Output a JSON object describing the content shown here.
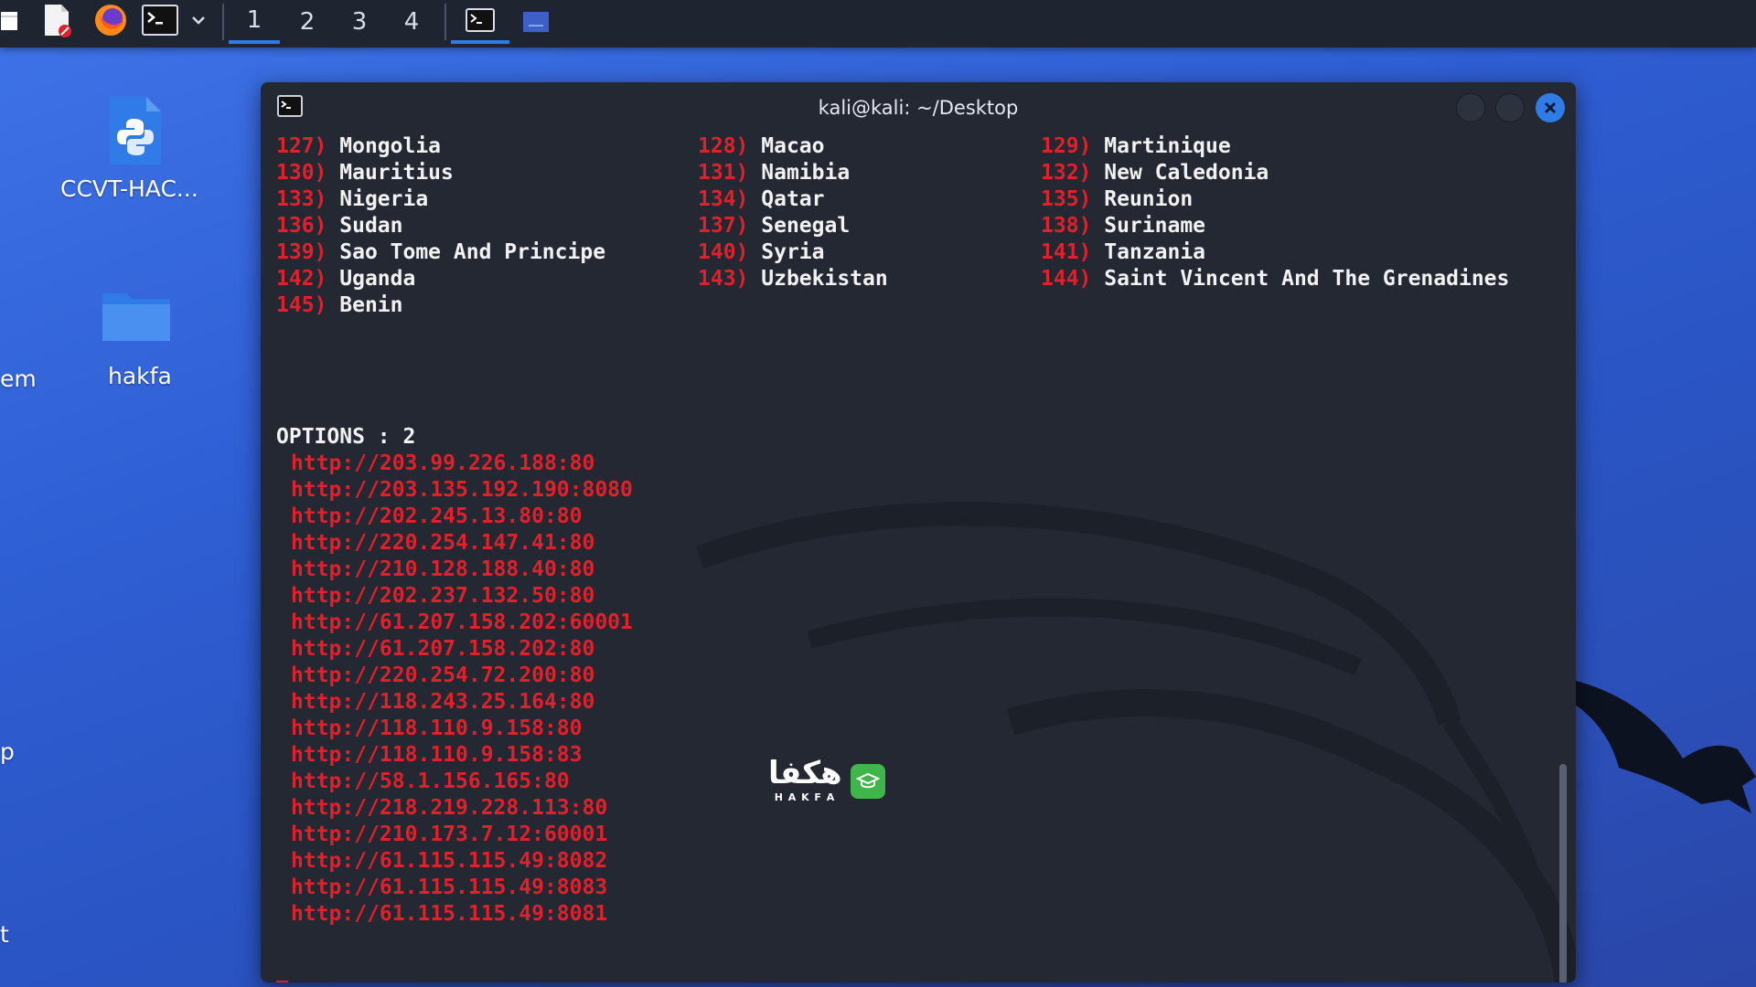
{
  "taskbar": {
    "workspaces": [
      "1",
      "2",
      "3",
      "4"
    ],
    "active_workspace": "1"
  },
  "desktop": {
    "items": [
      {
        "label": "CCVT-HAC...",
        "icon": "python-file-icon"
      },
      {
        "label": "hakfa",
        "icon": "folder-icon"
      }
    ],
    "partial_labels": [
      "em",
      "p",
      "t"
    ]
  },
  "terminal": {
    "title": "kali@kali: ~/Desktop",
    "countries": [
      {
        "num": "127)",
        "name": "Mongolia"
      },
      {
        "num": "128)",
        "name": "Macao"
      },
      {
        "num": "129)",
        "name": "Martinique"
      },
      {
        "num": "130)",
        "name": "Mauritius"
      },
      {
        "num": "131)",
        "name": "Namibia"
      },
      {
        "num": "132)",
        "name": "New Caledonia"
      },
      {
        "num": "133)",
        "name": "Nigeria"
      },
      {
        "num": "134)",
        "name": "Qatar"
      },
      {
        "num": "135)",
        "name": "Reunion"
      },
      {
        "num": "136)",
        "name": "Sudan"
      },
      {
        "num": "137)",
        "name": "Senegal"
      },
      {
        "num": "138)",
        "name": "Suriname"
      },
      {
        "num": "139)",
        "name": "Sao Tome And Principe"
      },
      {
        "num": "140)",
        "name": "Syria"
      },
      {
        "num": "141)",
        "name": "Tanzania"
      },
      {
        "num": "142)",
        "name": "Uganda"
      },
      {
        "num": "143)",
        "name": "Uzbekistan"
      },
      {
        "num": "144)",
        "name": "Saint Vincent And The Grenadines"
      },
      {
        "num": "145)",
        "name": "Benin"
      }
    ],
    "options_line": "OPTIONS : 2",
    "urls": [
      "http://203.99.226.188:80",
      "http://203.135.192.190:8080",
      "http://202.245.13.80:80",
      "http://220.254.147.41:80",
      "http://210.128.188.40:80",
      "http://202.237.132.50:80",
      "http://61.207.158.202:60001",
      "http://61.207.158.202:80",
      "http://220.254.72.200:80",
      "http://118.243.25.164:80",
      "http://118.110.9.158:80",
      "http://118.110.9.158:83",
      "http://58.1.156.165:80",
      "http://218.219.228.113:80",
      "http://210.173.7.12:60001",
      "http://61.115.115.49:8082",
      "http://61.115.115.49:8083",
      "http://61.115.115.49:8081"
    ]
  },
  "watermark": {
    "arabic": "هکفا",
    "latin": "H A K F A"
  },
  "colors": {
    "accent": "#2f7be8",
    "terminal_bg": "#232833",
    "terminal_red": "#e0202a",
    "terminal_text": "#f2f2f2"
  }
}
